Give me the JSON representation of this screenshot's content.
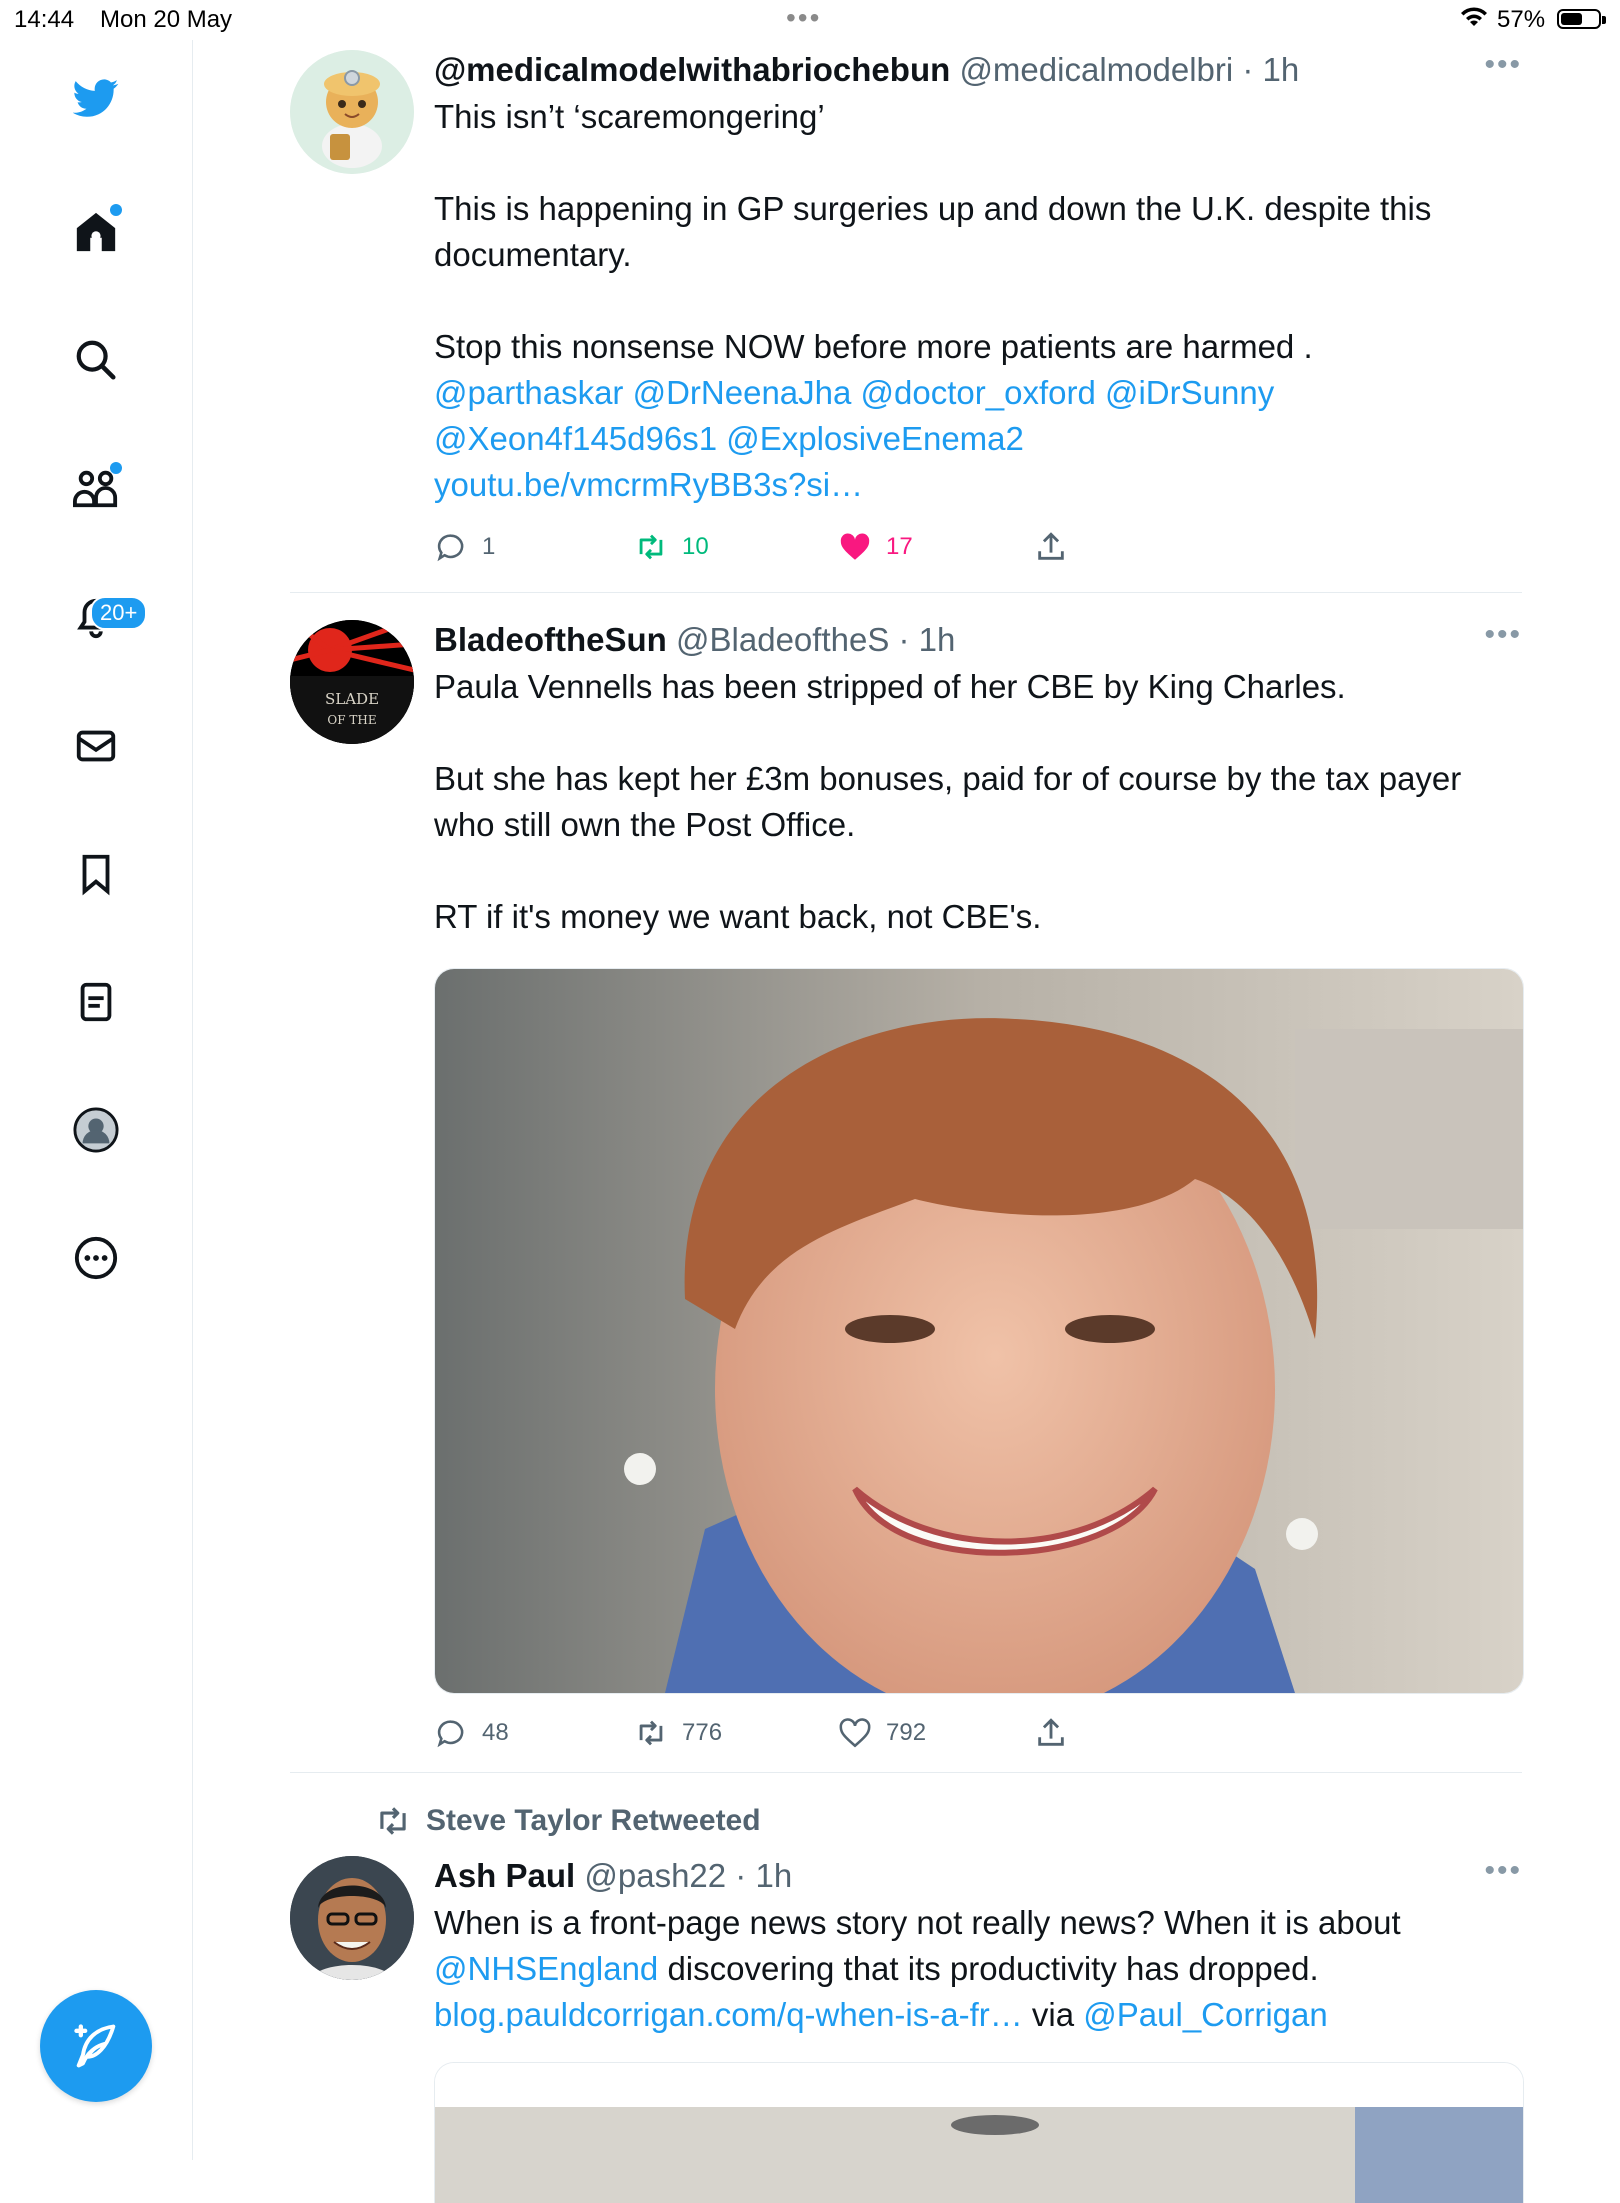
{
  "status_bar": {
    "time": "14:44",
    "date": "Mon 20 May",
    "battery": "57%",
    "battery_level": 0.57
  },
  "sidebar": {
    "items": [
      {
        "icon": "twitter-logo-icon"
      },
      {
        "icon": "home-icon"
      },
      {
        "icon": "search-icon"
      },
      {
        "icon": "communities-icon"
      },
      {
        "icon": "notifications-bell-icon",
        "badge": "20+"
      },
      {
        "icon": "messages-envelope-icon"
      },
      {
        "icon": "bookmark-icon"
      },
      {
        "icon": "lists-icon"
      },
      {
        "icon": "profile-avatar-icon"
      },
      {
        "icon": "more-circle-icon"
      }
    ],
    "compose_icon": "compose-feather-icon"
  },
  "accent_color": "#1d9bf0",
  "like_color": "#f91880",
  "retweet_color": "#00ba7c",
  "tweets": [
    {
      "name": "@medicalmodelwithabriochebun",
      "handle": "@medicalmodelbri",
      "time": "1h",
      "text_1": "This isn’t ‘scaremongering’\n\nThis is happening in GP surgeries up and down the U.K. despite this documentary.\n\nStop this nonsense NOW before more patients are harmed .",
      "mentions_1": "@parthaskar @DrNeenaJha @doctor_oxford @iDrSunny",
      "mentions_2": "@Xeon4f145d96s1 @ExplosiveEnema2",
      "link": "youtu.be/vmcrmRyBB3s?si…",
      "replies": "1",
      "retweets": "10",
      "likes": "17",
      "liked": true,
      "retweeted": true
    },
    {
      "name": "BladeoftheSun",
      "handle": "@BladeoftheS",
      "time": "1h",
      "text": "Paula Vennells has been stripped of her CBE by King Charles.\n\nBut she has kept her £3m bonuses, paid for of course by the tax payer who still own the Post Office.\n\nRT if it's money we want back, not CBE's.",
      "avatar_text": "BLADE OF THE",
      "replies": "48",
      "retweets": "776",
      "likes": "792"
    },
    {
      "retweeted_by": "Steve Taylor Retweeted",
      "name": "Ash Paul",
      "handle": "@pash22",
      "time": "1h",
      "text_1": "When is a front-page news story not really news? When it is about",
      "mention_1": "@NHSEngland",
      "text_2": " discovering that its productivity has dropped.",
      "link": "blog.pauldcorrigan.com/q-when-is-a-fr…",
      "text_3": " via ",
      "mention_2": "@Paul_Corrigan"
    }
  ]
}
